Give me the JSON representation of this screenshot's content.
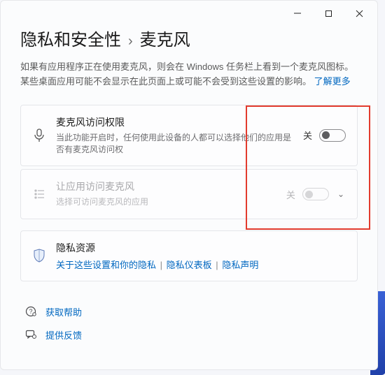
{
  "titlebar": {
    "min": "—",
    "max": "□",
    "close": "✕"
  },
  "breadcrumb": {
    "parent": "隐私和安全性",
    "sep": "›",
    "current": "麦克风"
  },
  "intro": {
    "text": "如果有应用程序正在使用麦克风，则会在 Windows 任务栏上看到一个麦克风图标。 某些桌面应用可能不会显示在此页面上或可能不会受到这些设置的影响。 ",
    "learn_more": "了解更多"
  },
  "cards": {
    "mic_access": {
      "title": "麦克风访问权限",
      "sub": "当此功能开启时，任何使用此设备的人都可以选择他们的应用是否有麦克风访问权",
      "state": "关"
    },
    "app_access": {
      "title": "让应用访问麦克风",
      "sub": "选择可访问麦克风的应用",
      "state": "关"
    },
    "privacy": {
      "title": "隐私资源",
      "link1": "关于这些设置和你的隐私",
      "link2": "隐私仪表板",
      "link3": "隐私声明",
      "sep": "|"
    }
  },
  "footer": {
    "help": "获取帮助",
    "feedback": "提供反馈"
  }
}
